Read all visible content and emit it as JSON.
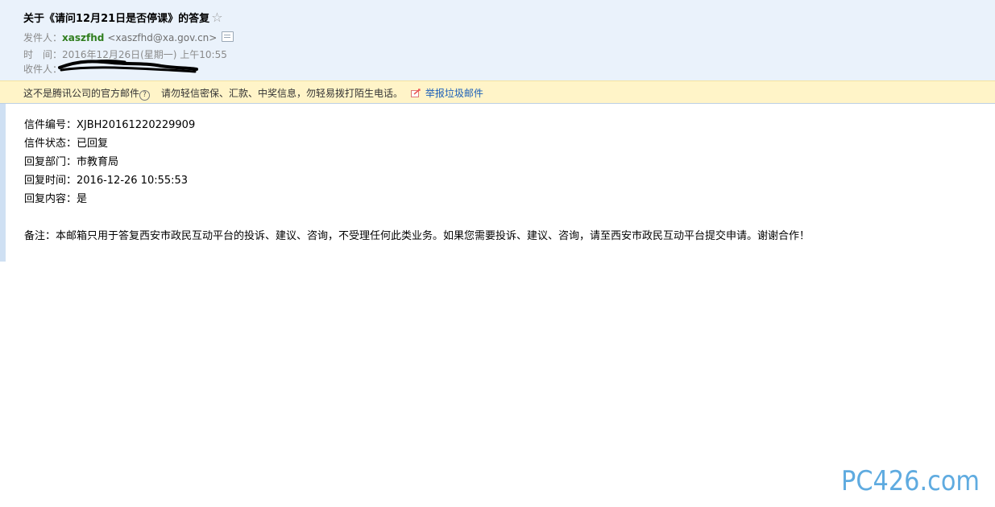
{
  "email": {
    "subject": "关于《请问12月21日是否停课》的答复",
    "star_glyph": "☆",
    "from_label": "发件人：",
    "from_name": "xaszfhd",
    "from_address": "<xaszfhd@xa.gov.cn>",
    "time_label": "时　间：",
    "time_value": "2016年12月26日(星期一) 上午10:55",
    "to_label": "收件人："
  },
  "warning": {
    "text": "这不是腾讯公司的官方邮件",
    "help_glyph": "?",
    "advice": "请勿轻信密保、汇款、中奖信息，勿轻易拨打陌生电话。",
    "report_label": "举报垃圾邮件"
  },
  "content": {
    "lines": [
      "信件编号：XJBH20161220229909",
      "信件状态：已回复",
      "回复部门：市教育局",
      "回复时间：2016-12-26 10:55:53",
      "回复内容：是"
    ],
    "note": "备注：本邮箱只用于答复西安市政民互动平台的投诉、建议、咨询，不受理任何此类业务。如果您需要投诉、建议、咨询，请至西安市政民互动平台提交申请。谢谢合作！"
  },
  "watermark": {
    "text": "PC426.com"
  },
  "colors": {
    "header_bg": "#eaf2fb",
    "warning_bg": "#fff4c8",
    "sender_green": "#2f7d1d",
    "link_blue": "#1b5fb8",
    "watermark_blue": "#2a8fd6"
  }
}
